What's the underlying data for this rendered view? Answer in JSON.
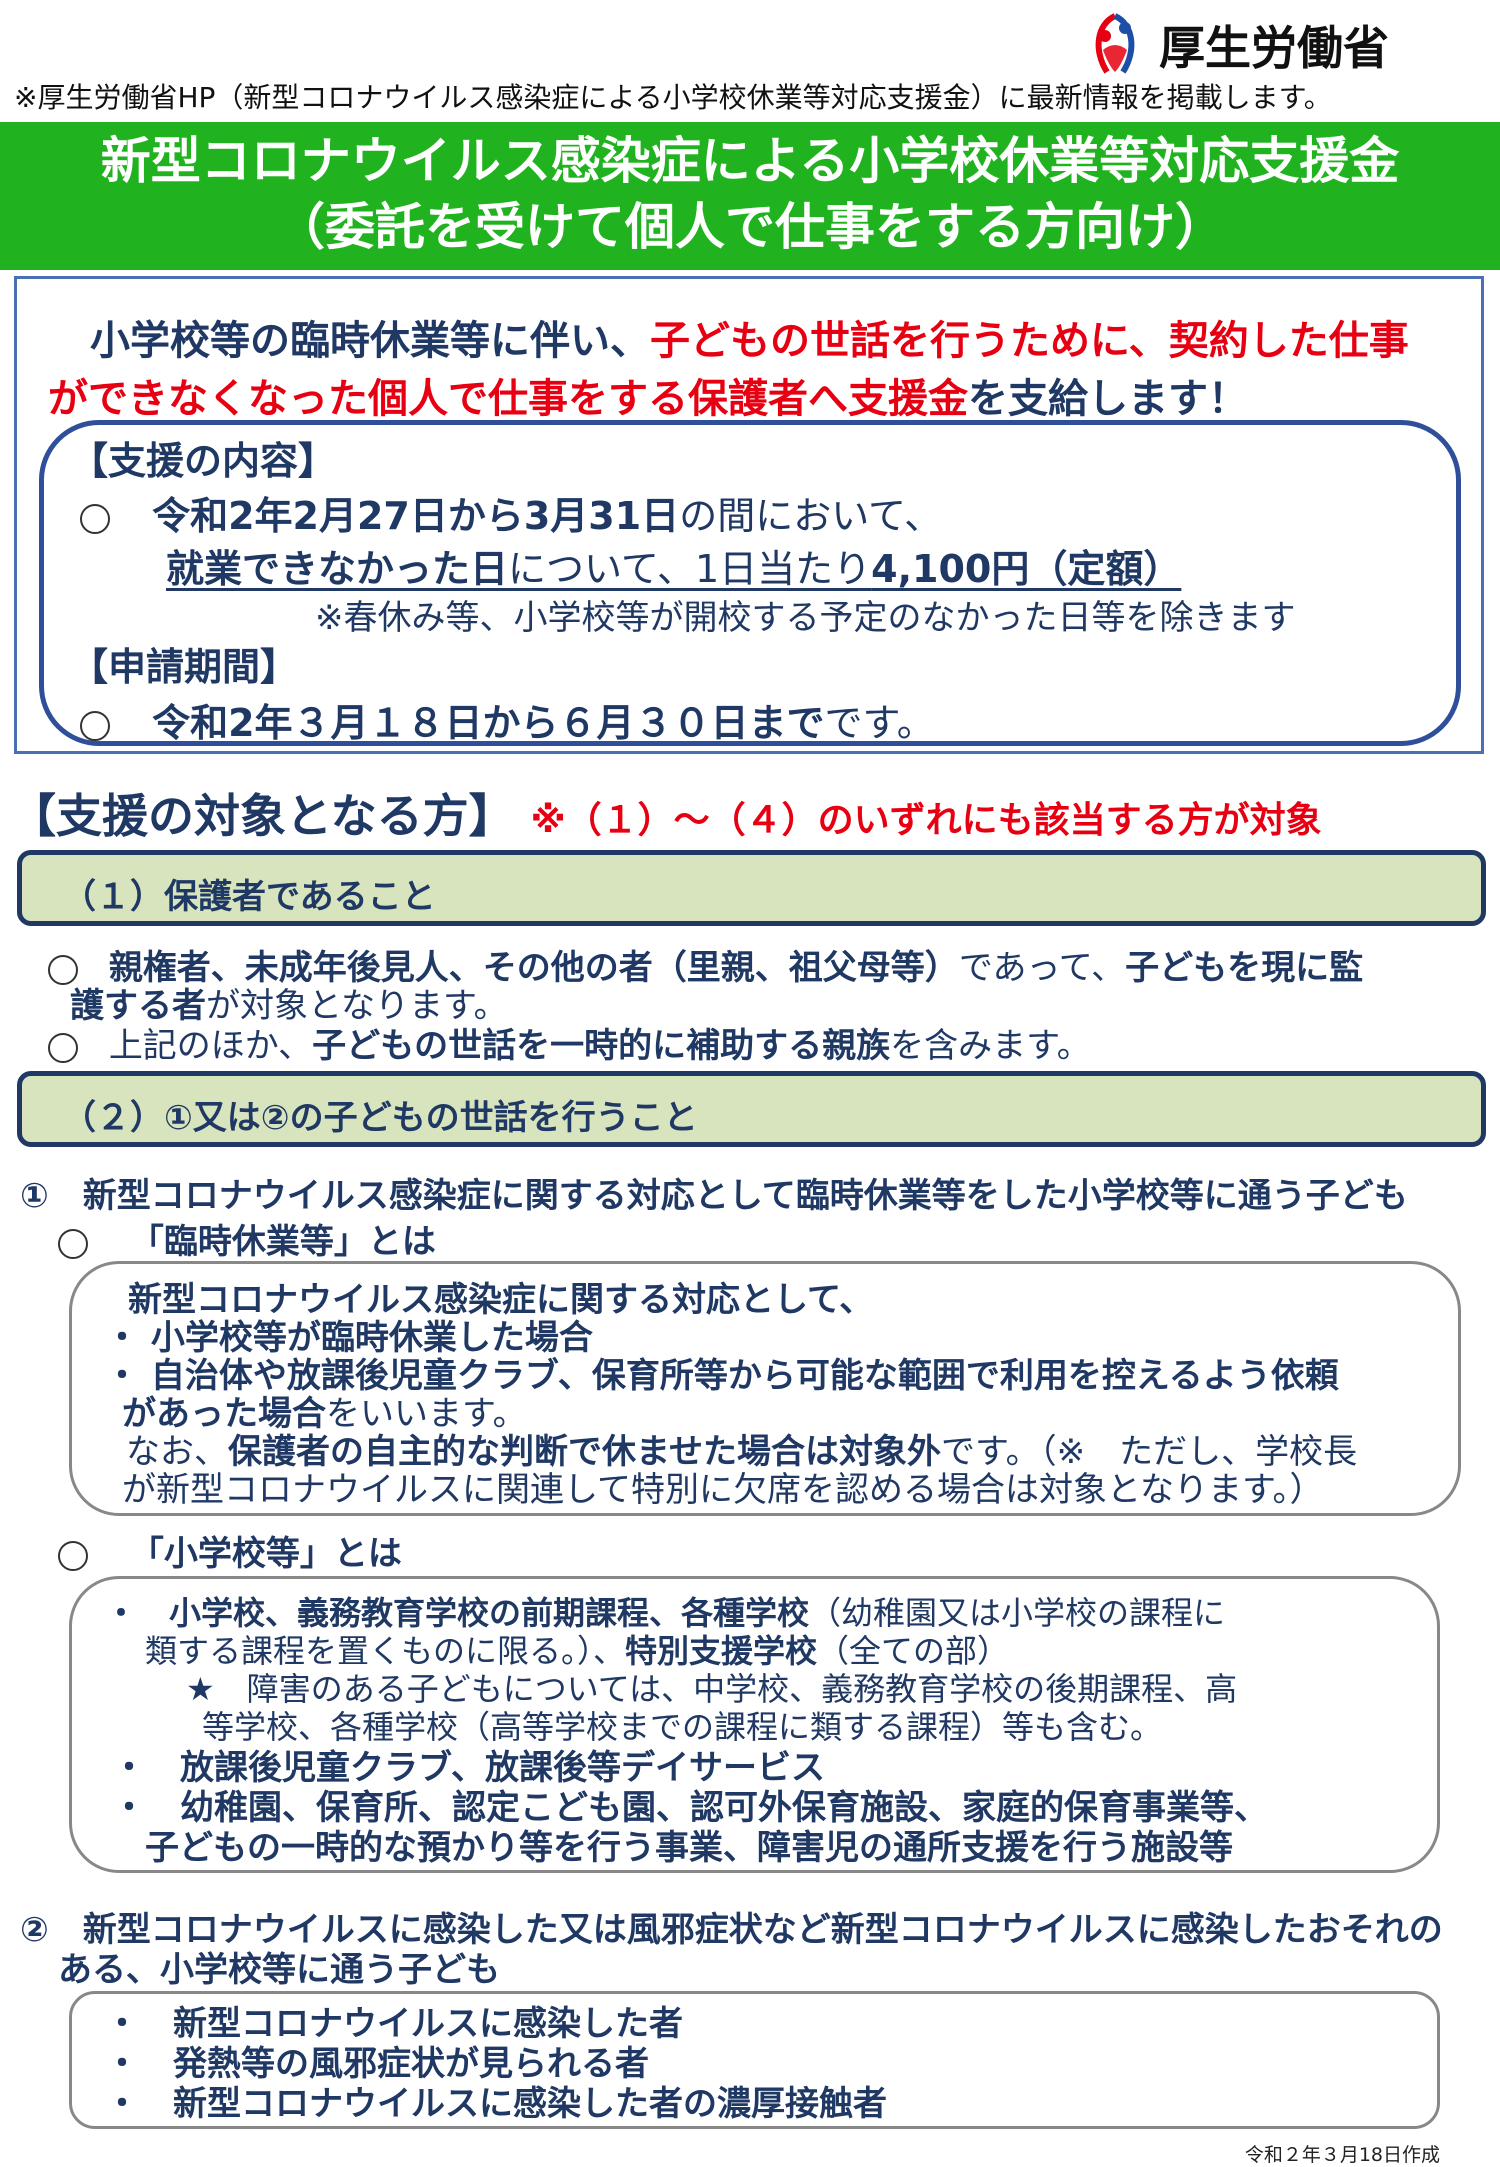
{
  "header": {
    "ministry_name": "厚生労働省",
    "note": "※厚生労働省HP（新型コロナウイルス感染症による小学校休業等対応支援金）に最新情報を掲載します。"
  },
  "banner": {
    "title_line1": "新型コロナウイルス感染症による小学校休業等対応支援金",
    "title_line2": "（委託を受けて個人で仕事をする方向け）"
  },
  "intro": {
    "line1": [
      {
        "t": "小学校等の臨時休業等に伴い、",
        "s": "b"
      },
      {
        "t": "子どもの世話を行うために、契約した仕事",
        "s": "r"
      }
    ],
    "line2": [
      {
        "t": "ができなくなった個人で仕事をする保護者へ支援金",
        "s": "r"
      },
      {
        "t": "を支給します！",
        "s": "b"
      }
    ]
  },
  "support": {
    "content_heading": "【支援の内容】",
    "content_line1": [
      {
        "t": "令和2年2月27日から3月31日",
        "s": "b"
      },
      {
        "t": "の間において、",
        "s": "n"
      }
    ],
    "content_line2": [
      {
        "t": "就業できなかった日",
        "s": "b u"
      },
      {
        "t": "について、1日当たり",
        "s": "n u"
      },
      {
        "t": "4,100円（定額）",
        "s": "b u"
      }
    ],
    "content_note": "※春休み等、小学校等が開校する予定のなかった日等を除きます",
    "period_heading": "【申請期間】",
    "period_line": [
      {
        "t": "令和2年３月１８日から６月３０日まで",
        "s": "b"
      },
      {
        "t": "です。",
        "s": "n"
      }
    ]
  },
  "target": {
    "heading": "【支援の対象となる方】",
    "heading_note": "※（１）～（４）のいずれにも該当する方が対象",
    "cond1": {
      "label": "（１）保護者であること",
      "line1": [
        {
          "t": "親権者、未成年後見人、その他の者（里親、祖父母等）",
          "s": "b"
        },
        {
          "t": "であって、",
          "s": "n"
        },
        {
          "t": "子どもを現に監",
          "s": "b"
        }
      ],
      "line2": [
        {
          "t": "護する者",
          "s": "b"
        },
        {
          "t": "が対象となります。",
          "s": "n"
        }
      ],
      "line3": [
        {
          "t": "上記のほか、",
          "s": "n"
        },
        {
          "t": "子どもの世話を一時的に補助する親族",
          "s": "b"
        },
        {
          "t": "を含みます。",
          "s": "n"
        }
      ]
    },
    "cond2": {
      "label": "（２）①又は②の子どもの世話を行うこと",
      "item1": "①　新型コロナウイルス感染症に関する対応として臨時休業等をした小学校等に通う子ども",
      "closure_heading": "「臨時休業等」とは",
      "closure": {
        "line1": "新型コロナウイルス感染症に関する対応として、",
        "line2": "・ 小学校等が臨時休業した場合",
        "line3": "・ 自治体や放課後児童クラブ、保育所等から可能な範囲で利用を控えるよう依頼",
        "line4": [
          {
            "t": "があった場合",
            "s": "b"
          },
          {
            "t": "をいいます。",
            "s": "n"
          }
        ],
        "line5": [
          {
            "t": "なお、",
            "s": "n"
          },
          {
            "t": "保護者の自主的な判断で休ませた場合は対象外",
            "s": "b"
          },
          {
            "t": "です。（※　ただし、学校長",
            "s": "n"
          }
        ],
        "line6": "が新型コロナウイルスに関連して特別に欠席を認める場合は対象となります。）"
      },
      "school_heading": "「小学校等」とは",
      "school": {
        "line1": [
          {
            "t": "・　小学校、義務教育学校の前期課程、各種学校",
            "s": "b"
          },
          {
            "t": "（幼稚園又は小学校の課程に",
            "s": "n"
          }
        ],
        "line2": [
          {
            "t": "類する課程を置くものに限る。）、",
            "s": "n"
          },
          {
            "t": "特別支援学校",
            "s": "b"
          },
          {
            "t": "（全ての部）",
            "s": "n"
          }
        ],
        "line3": "★　障害のある子どもについては、中学校、義務教育学校の後期課程、高",
        "line4": "等学校、各種学校（高等学校までの課程に類する課程）等も含む。",
        "line5": "・　放課後児童クラブ、放課後等デイサービス",
        "line6": "・　幼稚園、保育所、認定こども園、認可外保育施設、家庭的保育事業等、",
        "line7": "子どもの一時的な預かり等を行う事業、障害児の通所支援を行う施設等"
      },
      "item2_line1": "②　新型コロナウイルスに感染した又は風邪症状など新型コロナウイルスに感染したおそれの",
      "item2_line2": "ある、小学校等に通う子ども",
      "infected": [
        "・　新型コロナウイルスに感染した者",
        "・　発熱等の風邪症状が見られる者",
        "・　新型コロナウイルスに感染した者の濃厚接触者"
      ]
    }
  },
  "footer": {
    "created": "令和２年３月18日作成"
  }
}
